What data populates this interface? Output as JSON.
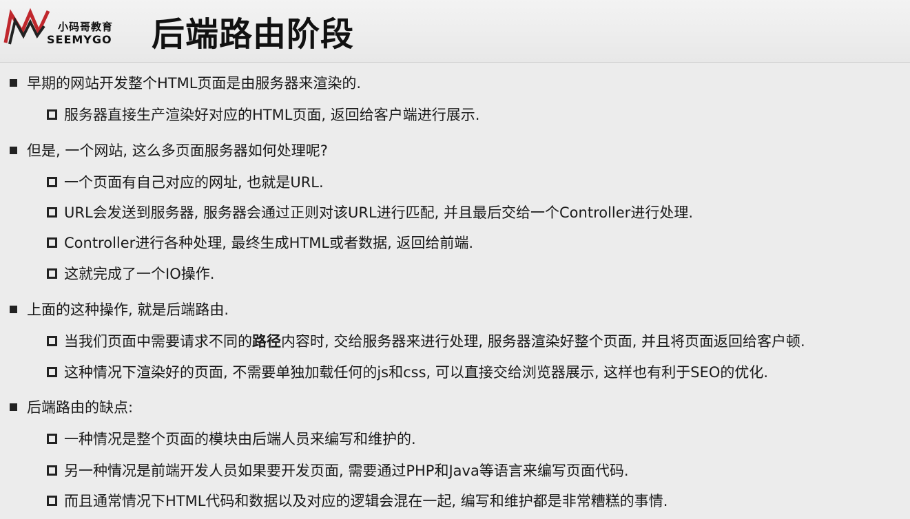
{
  "logo": {
    "cn": "小码哥教育",
    "en": "SEEMYGO"
  },
  "title": "后端路由阶段",
  "sections": [
    {
      "text": "早期的网站开发整个HTML页面是由服务器来渲染的.",
      "items": [
        "服务器直接生产渲染好对应的HTML页面, 返回给客户端进行展示."
      ]
    },
    {
      "text": "但是, 一个网站, 这么多页面服务器如何处理呢?",
      "items": [
        "一个页面有自己对应的网址, 也就是URL.",
        "URL会发送到服务器, 服务器会通过正则对该URL进行匹配, 并且最后交给一个Controller进行处理.",
        "Controller进行各种处理, 最终生成HTML或者数据, 返回给前端.",
        "这就完成了一个IO操作."
      ]
    },
    {
      "text": "上面的这种操作, 就是后端路由.",
      "items": [
        {
          "before": "当我们页面中需要请求不同的",
          "bold": "路径",
          "after": "内容时, 交给服务器来进行处理, 服务器渲染好整个页面, 并且将页面返回给客户顿."
        },
        "这种情况下渲染好的页面, 不需要单独加载任何的js和css, 可以直接交给浏览器展示, 这样也有利于SEO的优化."
      ]
    },
    {
      "text": "后端路由的缺点:",
      "items": [
        "一种情况是整个页面的模块由后端人员来编写和维护的.",
        "另一种情况是前端开发人员如果要开发页面, 需要通过PHP和Java等语言来编写页面代码.",
        "而且通常情况下HTML代码和数据以及对应的逻辑会混在一起, 编写和维护都是非常糟糕的事情."
      ]
    }
  ]
}
